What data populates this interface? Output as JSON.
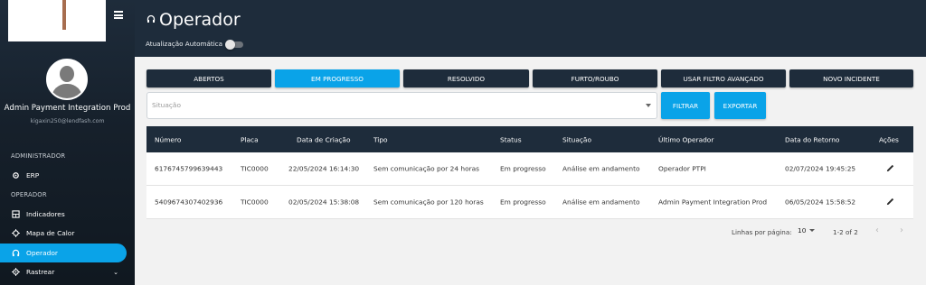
{
  "sidebar": {
    "user_name": "Admin Payment Integration Prod",
    "user_email": "kigaxin250@lendfash.com",
    "sections": [
      "ADMINISTRADOR",
      "OPERADOR"
    ],
    "items": [
      {
        "label": "ERP",
        "icon": "gear-icon"
      },
      {
        "label": "Indicadores",
        "icon": "dashboard-icon"
      },
      {
        "label": "Mapa de Calor",
        "icon": "map-icon"
      },
      {
        "label": "Operador",
        "icon": "headset-icon",
        "active": true
      },
      {
        "label": "Rastrear",
        "icon": "target-icon"
      }
    ]
  },
  "header": {
    "title": "Operador",
    "auto_update_label": "Atualização Automática"
  },
  "tabs": [
    "ABERTOS",
    "EM PROGRESSO",
    "RESOLVIDO",
    "FURTO/ROUBO",
    "USAR FILTRO AVANÇADO",
    "NOVO INCIDENTE"
  ],
  "active_tab": "EM PROGRESSO",
  "filter": {
    "situacao_placeholder": "Situação",
    "filter_button": "FILTRAR",
    "export_button": "EXPORTAR"
  },
  "table": {
    "columns": [
      "Número",
      "Placa",
      "Data de Criação",
      "Tipo",
      "Status",
      "Situação",
      "Último Operador",
      "Data do Retorno",
      "Ações"
    ],
    "rows": [
      [
        "6176745799639443",
        "TIC0000",
        "22/05/2024 16:14:30",
        "Sem comunicação por 24 horas",
        "Em progresso",
        "Análise em andamento",
        "Operador PTPI",
        "02/07/2024 19:45:25"
      ],
      [
        "5409674307402936",
        "TIC0000",
        "02/05/2024 15:38:08",
        "Sem comunicação por 120 horas",
        "Em progresso",
        "Análise em andamento",
        "Admin Payment Integration Prod",
        "06/05/2024 15:58:52"
      ]
    ]
  },
  "pagination": {
    "rows_per_page_label": "Linhas por página:",
    "rows_per_page": "10",
    "range": "1-2 of 2"
  },
  "colors": {
    "navy": "#1e2c3b",
    "accent": "#0aa3e8"
  }
}
